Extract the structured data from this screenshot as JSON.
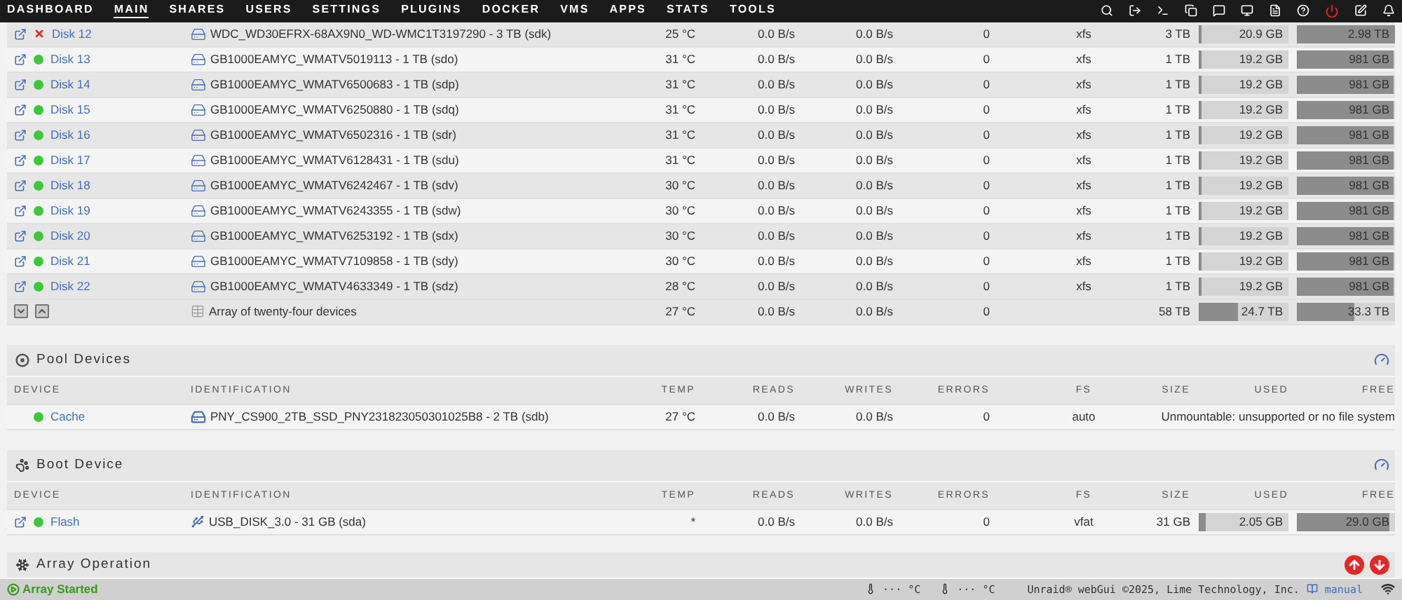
{
  "nav": {
    "items": [
      {
        "label": "DASHBOARD",
        "selected": false
      },
      {
        "label": "MAIN",
        "selected": true
      },
      {
        "label": "SHARES",
        "selected": false
      },
      {
        "label": "USERS",
        "selected": false
      },
      {
        "label": "SETTINGS",
        "selected": false
      },
      {
        "label": "PLUGINS",
        "selected": false
      },
      {
        "label": "DOCKER",
        "selected": false
      },
      {
        "label": "VMS",
        "selected": false
      },
      {
        "label": "APPS",
        "selected": false
      },
      {
        "label": "STATS",
        "selected": false
      },
      {
        "label": "TOOLS",
        "selected": false
      }
    ]
  },
  "array": {
    "rows": [
      {
        "name": "Disk 12",
        "failed": true,
        "identification": "WDC_WD30EFRX-68AX9N0_WD-WMC1T3197290 - 3 TB (sdk)",
        "temp": "25 °C",
        "reads": "0.0 B/s",
        "writes": "0.0 B/s",
        "errors": "0",
        "fs": "xfs",
        "size": "3 TB",
        "used": {
          "text": "20.9 GB",
          "level": 0.007
        },
        "free": {
          "text": "2.98 TB",
          "level": 0.993
        }
      },
      {
        "name": "Disk 13",
        "failed": false,
        "identification": "GB1000EAMYC_WMATV5019113 - 1 TB (sdo)",
        "temp": "31 °C",
        "reads": "0.0 B/s",
        "writes": "0.0 B/s",
        "errors": "0",
        "fs": "xfs",
        "size": "1 TB",
        "used": {
          "text": "19.2 GB",
          "level": 0.019
        },
        "free": {
          "text": "981 GB",
          "level": 0.981
        }
      },
      {
        "name": "Disk 14",
        "failed": false,
        "identification": "GB1000EAMYC_WMATV6500683 - 1 TB (sdp)",
        "temp": "31 °C",
        "reads": "0.0 B/s",
        "writes": "0.0 B/s",
        "errors": "0",
        "fs": "xfs",
        "size": "1 TB",
        "used": {
          "text": "19.2 GB",
          "level": 0.019
        },
        "free": {
          "text": "981 GB",
          "level": 0.981
        }
      },
      {
        "name": "Disk 15",
        "failed": false,
        "identification": "GB1000EAMYC_WMATV6250880 - 1 TB (sdq)",
        "temp": "31 °C",
        "reads": "0.0 B/s",
        "writes": "0.0 B/s",
        "errors": "0",
        "fs": "xfs",
        "size": "1 TB",
        "used": {
          "text": "19.2 GB",
          "level": 0.019
        },
        "free": {
          "text": "981 GB",
          "level": 0.981
        }
      },
      {
        "name": "Disk 16",
        "failed": false,
        "identification": "GB1000EAMYC_WMATV6502316 - 1 TB (sdr)",
        "temp": "31 °C",
        "reads": "0.0 B/s",
        "writes": "0.0 B/s",
        "errors": "0",
        "fs": "xfs",
        "size": "1 TB",
        "used": {
          "text": "19.2 GB",
          "level": 0.019
        },
        "free": {
          "text": "981 GB",
          "level": 0.981
        }
      },
      {
        "name": "Disk 17",
        "failed": false,
        "identification": "GB1000EAMYC_WMATV6128431 - 1 TB (sdu)",
        "temp": "31 °C",
        "reads": "0.0 B/s",
        "writes": "0.0 B/s",
        "errors": "0",
        "fs": "xfs",
        "size": "1 TB",
        "used": {
          "text": "19.2 GB",
          "level": 0.019
        },
        "free": {
          "text": "981 GB",
          "level": 0.981
        }
      },
      {
        "name": "Disk 18",
        "failed": false,
        "identification": "GB1000EAMYC_WMATV6242467 - 1 TB (sdv)",
        "temp": "30 °C",
        "reads": "0.0 B/s",
        "writes": "0.0 B/s",
        "errors": "0",
        "fs": "xfs",
        "size": "1 TB",
        "used": {
          "text": "19.2 GB",
          "level": 0.019
        },
        "free": {
          "text": "981 GB",
          "level": 0.981
        }
      },
      {
        "name": "Disk 19",
        "failed": false,
        "identification": "GB1000EAMYC_WMATV6243355 - 1 TB (sdw)",
        "temp": "30 °C",
        "reads": "0.0 B/s",
        "writes": "0.0 B/s",
        "errors": "0",
        "fs": "xfs",
        "size": "1 TB",
        "used": {
          "text": "19.2 GB",
          "level": 0.019
        },
        "free": {
          "text": "981 GB",
          "level": 0.981
        }
      },
      {
        "name": "Disk 20",
        "failed": false,
        "identification": "GB1000EAMYC_WMATV6253192 - 1 TB (sdx)",
        "temp": "30 °C",
        "reads": "0.0 B/s",
        "writes": "0.0 B/s",
        "errors": "0",
        "fs": "xfs",
        "size": "1 TB",
        "used": {
          "text": "19.2 GB",
          "level": 0.019
        },
        "free": {
          "text": "981 GB",
          "level": 0.981
        }
      },
      {
        "name": "Disk 21",
        "failed": false,
        "identification": "GB1000EAMYC_WMATV7109858 - 1 TB (sdy)",
        "temp": "30 °C",
        "reads": "0.0 B/s",
        "writes": "0.0 B/s",
        "errors": "0",
        "fs": "xfs",
        "size": "1 TB",
        "used": {
          "text": "19.2 GB",
          "level": 0.019
        },
        "free": {
          "text": "981 GB",
          "level": 0.981
        }
      },
      {
        "name": "Disk 22",
        "failed": false,
        "identification": "GB1000EAMYC_WMATV4633349 - 1 TB (sdz)",
        "temp": "28 °C",
        "reads": "0.0 B/s",
        "writes": "0.0 B/s",
        "errors": "0",
        "fs": "xfs",
        "size": "1 TB",
        "used": {
          "text": "19.2 GB",
          "level": 0.019
        },
        "free": {
          "text": "981 GB",
          "level": 0.981
        }
      }
    ],
    "total": {
      "identification": "Array of twenty-four devices",
      "temp": "27 °C",
      "reads": "0.0 B/s",
      "writes": "0.0 B/s",
      "errors": "0",
      "size": "58 TB",
      "used": {
        "text": "24.7 TB",
        "level": 0.426
      },
      "free": {
        "text": "33.3 TB",
        "level": 0.574
      }
    }
  },
  "pool": {
    "title": "Pool Devices",
    "columns": [
      "DEVICE",
      "IDENTIFICATION",
      "TEMP",
      "READS",
      "WRITES",
      "ERRORS",
      "FS",
      "SIZE",
      "USED",
      "FREE"
    ],
    "rows": [
      {
        "name": "Cache",
        "failed": false,
        "link": false,
        "kind": "ssd",
        "identification": "PNY_CS900_2TB_SSD_PNY231823050301025B8 - 2 TB (sdb)",
        "temp": "27 °C",
        "reads": "0.0 B/s",
        "writes": "0.0 B/s",
        "errors": "0",
        "fs": "auto",
        "message": "Unmountable: unsupported or no file system"
      }
    ]
  },
  "boot": {
    "title": "Boot Device",
    "columns": [
      "DEVICE",
      "IDENTIFICATION",
      "TEMP",
      "READS",
      "WRITES",
      "ERRORS",
      "FS",
      "SIZE",
      "USED",
      "FREE"
    ],
    "rows": [
      {
        "name": "Flash",
        "failed": false,
        "link": true,
        "kind": "usb",
        "identification": "USB_DISK_3.0 - 31 GB (sda)",
        "temp": "*",
        "reads": "0.0 B/s",
        "writes": "0.0 B/s",
        "errors": "0",
        "fs": "vfat",
        "size": "31 GB",
        "used": {
          "text": "2.05 GB",
          "level": 0.066
        },
        "free": {
          "text": "29.0 GB",
          "level": 0.935
        }
      }
    ]
  },
  "array_operation": {
    "title": "Array Operation"
  },
  "status_bar": {
    "array_status": "Array Started",
    "temps": [
      "··· °C",
      "··· °C"
    ],
    "copyright": "Unraid® webGui ©2025, Lime Technology, Inc.",
    "manual": "manual"
  }
}
